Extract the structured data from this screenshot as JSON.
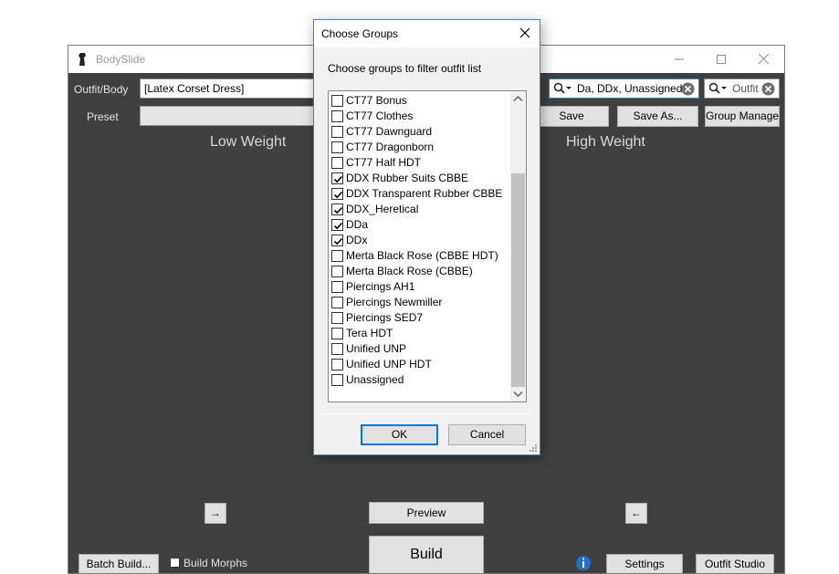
{
  "main_window": {
    "title": "BodySlide",
    "outfit_label": "Outfit/Body",
    "outfit_value": "[Latex Corset Dress]",
    "preset_label": "Preset",
    "group_filter_value": "Da, DDx, Unassigned",
    "outfit_filter_placeholder": "Outfit",
    "save_label": "Save",
    "save_as_label": "Save As...",
    "group_manage_label": "Group Manage",
    "low_weight_label": "Low Weight",
    "high_weight_label": "High Weight",
    "left_arrow_label": "→",
    "right_arrow_label": "←",
    "preview_label": "Preview",
    "build_label": "Build",
    "batch_build_label": "Batch Build...",
    "build_morphs_label": "Build Morphs",
    "settings_label": "Settings",
    "outfit_studio_label": "Outfit Studio"
  },
  "dialog": {
    "title": "Choose Groups",
    "instruction": "Choose groups to filter outfit list",
    "ok_label": "OK",
    "cancel_label": "Cancel",
    "groups": [
      {
        "label": "CT77 Bonus",
        "checked": false
      },
      {
        "label": "CT77 Clothes",
        "checked": false
      },
      {
        "label": "CT77 Dawnguard",
        "checked": false
      },
      {
        "label": "CT77 Dragonborn",
        "checked": false
      },
      {
        "label": "CT77 Half HDT",
        "checked": false
      },
      {
        "label": "DDX Rubber Suits CBBE",
        "checked": true
      },
      {
        "label": "DDX Transparent Rubber CBBE",
        "checked": true
      },
      {
        "label": "DDX_Heretical",
        "checked": true
      },
      {
        "label": "DDa",
        "checked": true
      },
      {
        "label": "DDx",
        "checked": true
      },
      {
        "label": "Merta Black Rose (CBBE HDT)",
        "checked": false
      },
      {
        "label": "Merta Black Rose (CBBE)",
        "checked": false
      },
      {
        "label": "Piercings AH1",
        "checked": false
      },
      {
        "label": "Piercings Newmiller",
        "checked": false
      },
      {
        "label": "Piercings SED7",
        "checked": false
      },
      {
        "label": "Tera HDT",
        "checked": false
      },
      {
        "label": "Unified UNP",
        "checked": false
      },
      {
        "label": "Unified UNP HDT",
        "checked": false
      },
      {
        "label": "Unassigned",
        "checked": false
      }
    ]
  },
  "colors": {
    "main_bg": "#404040",
    "dialog_border": "#3a84c8",
    "ok_focus": "#0078d7"
  }
}
